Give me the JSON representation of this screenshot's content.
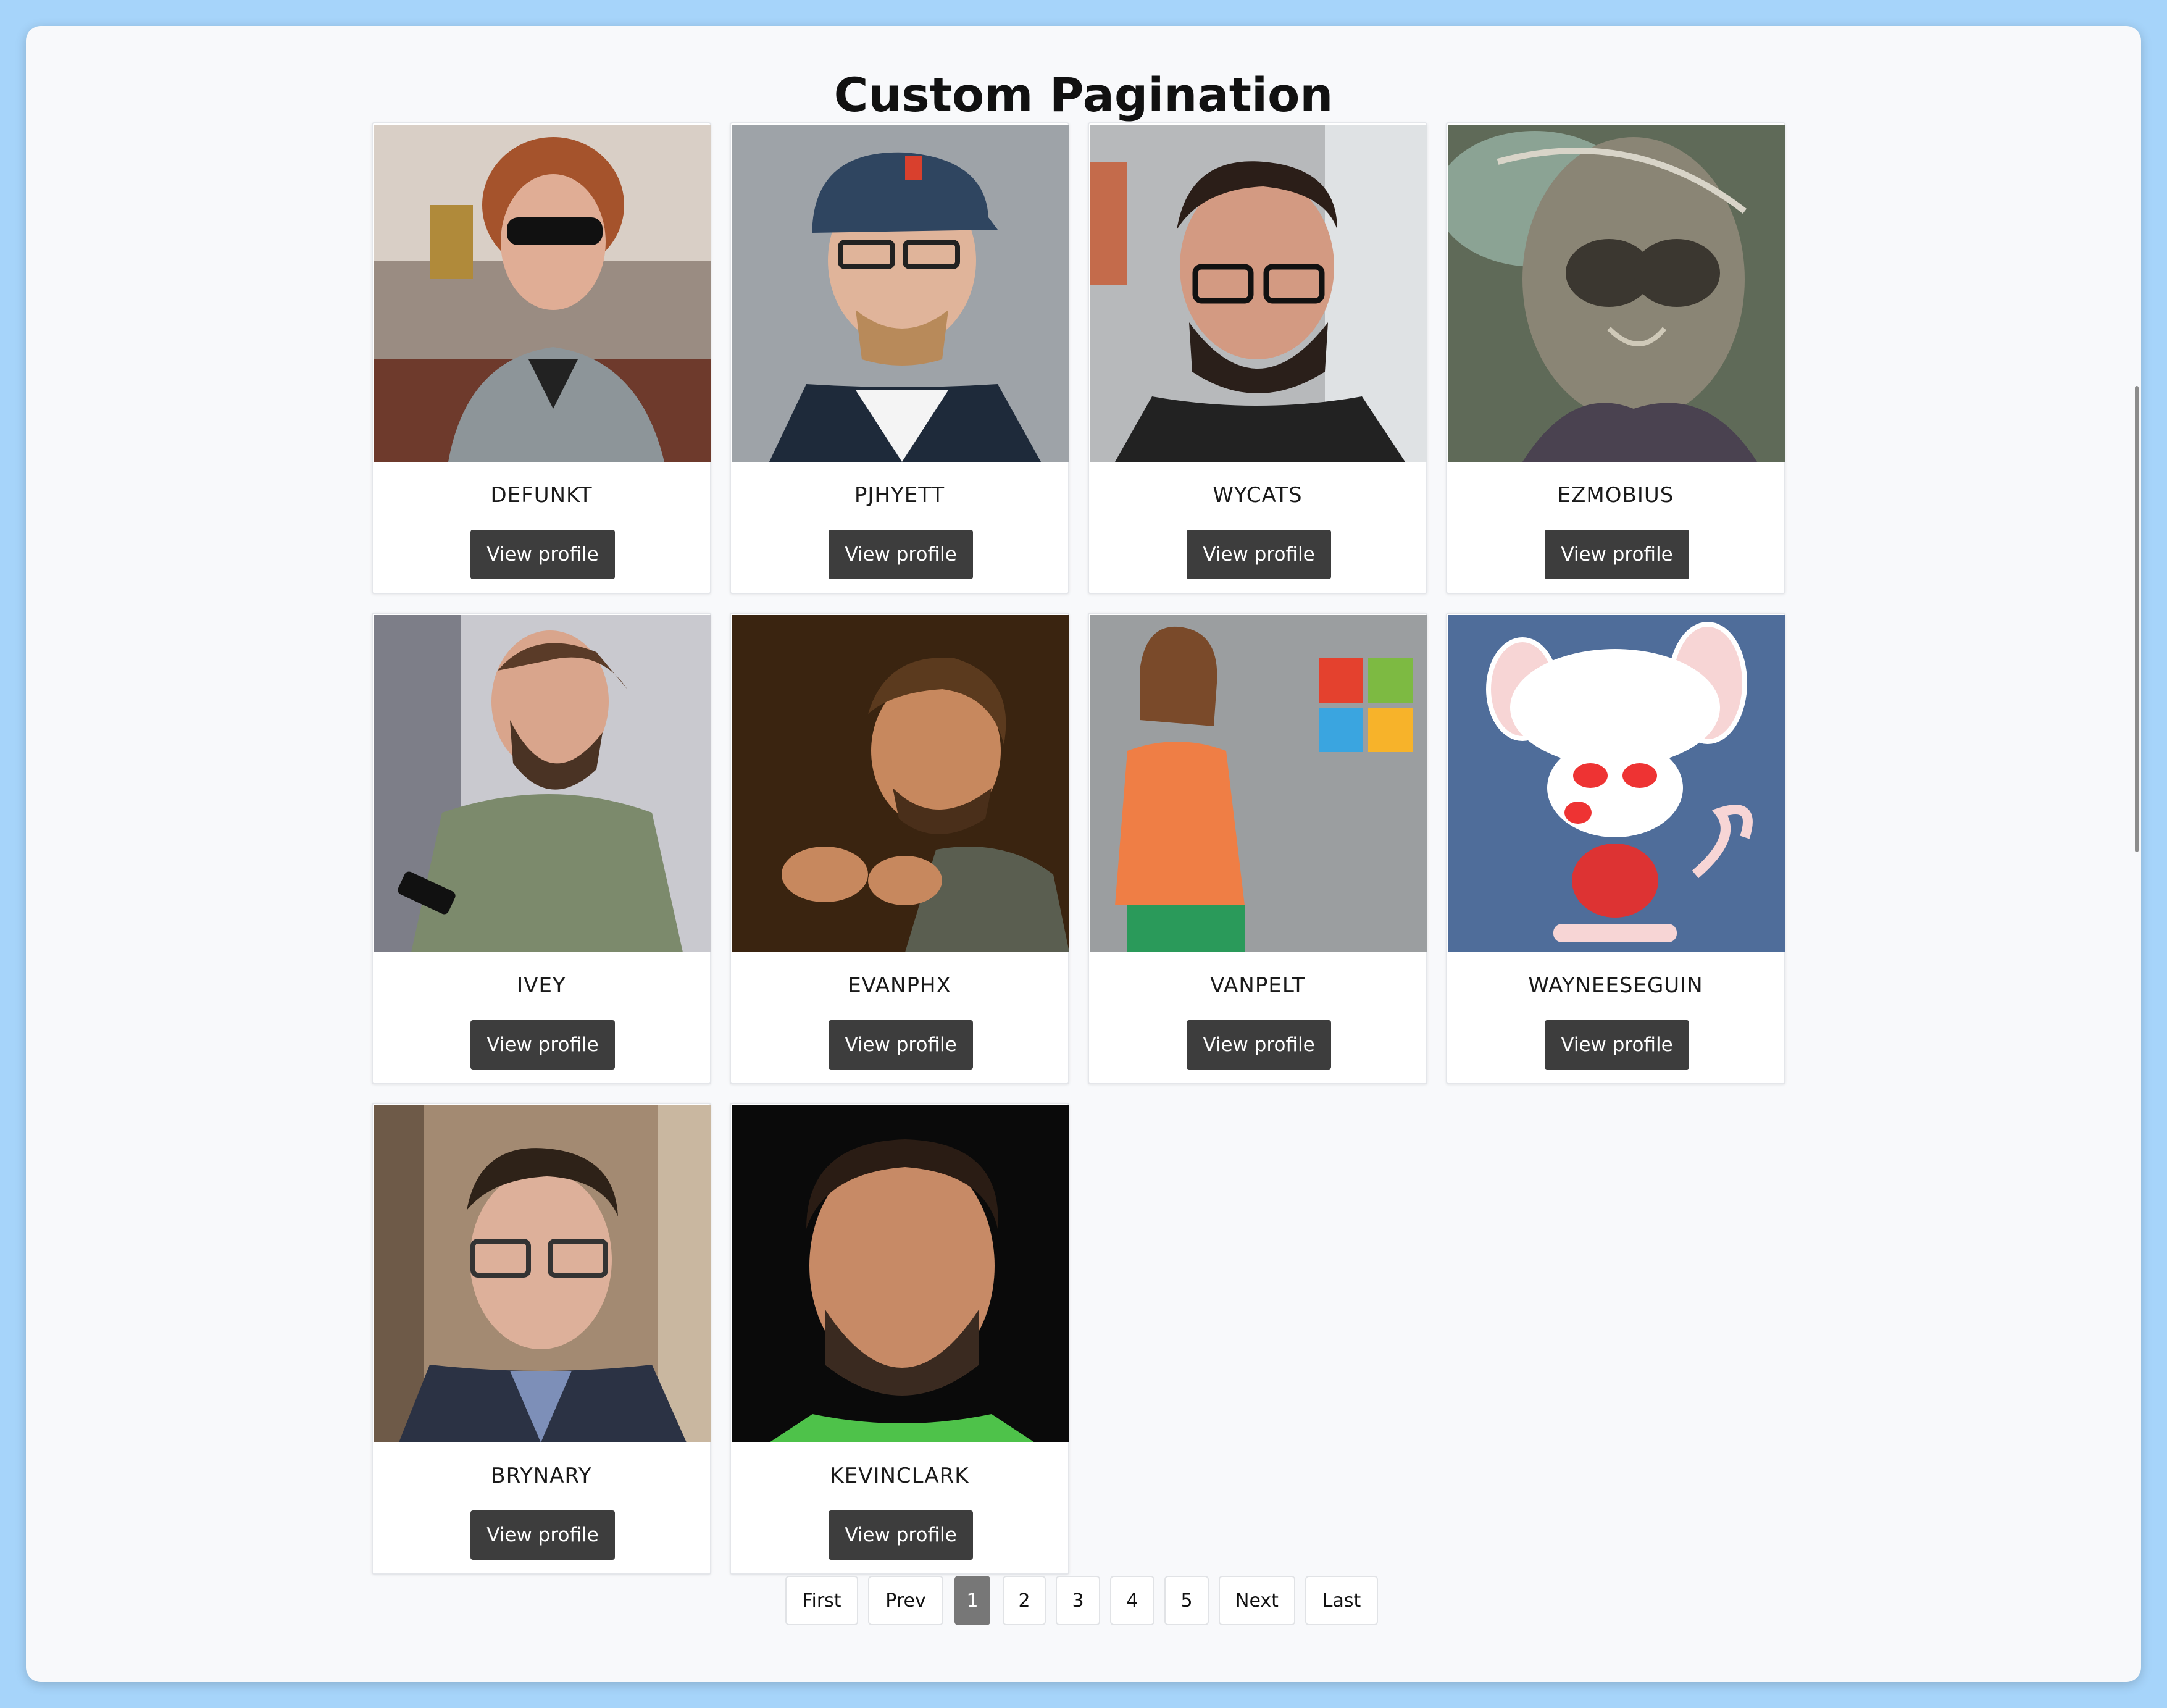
{
  "page": {
    "title": "Custom Pagination"
  },
  "users": [
    {
      "login": "DEFUNKT",
      "button": "View profile"
    },
    {
      "login": "PJHYETT",
      "button": "View profile"
    },
    {
      "login": "WYCATS",
      "button": "View profile"
    },
    {
      "login": "EZMOBIUS",
      "button": "View profile"
    },
    {
      "login": "IVEY",
      "button": "View profile"
    },
    {
      "login": "EVANPHX",
      "button": "View profile"
    },
    {
      "login": "VANPELT",
      "button": "View profile"
    },
    {
      "login": "WAYNEESEGUIN",
      "button": "View profile"
    },
    {
      "login": "BRYNARY",
      "button": "View profile"
    },
    {
      "login": "KEVINCLARK",
      "button": "View profile"
    }
  ],
  "pagination": {
    "first": "First",
    "prev": "Prev",
    "pages": [
      "1",
      "2",
      "3",
      "4",
      "5"
    ],
    "current": "1",
    "next": "Next",
    "last": "Last"
  },
  "colors": {
    "background": "#a6d4fa",
    "panel": "#f8f9fb",
    "button": "#3d3d3d",
    "active_page": "#777777"
  }
}
